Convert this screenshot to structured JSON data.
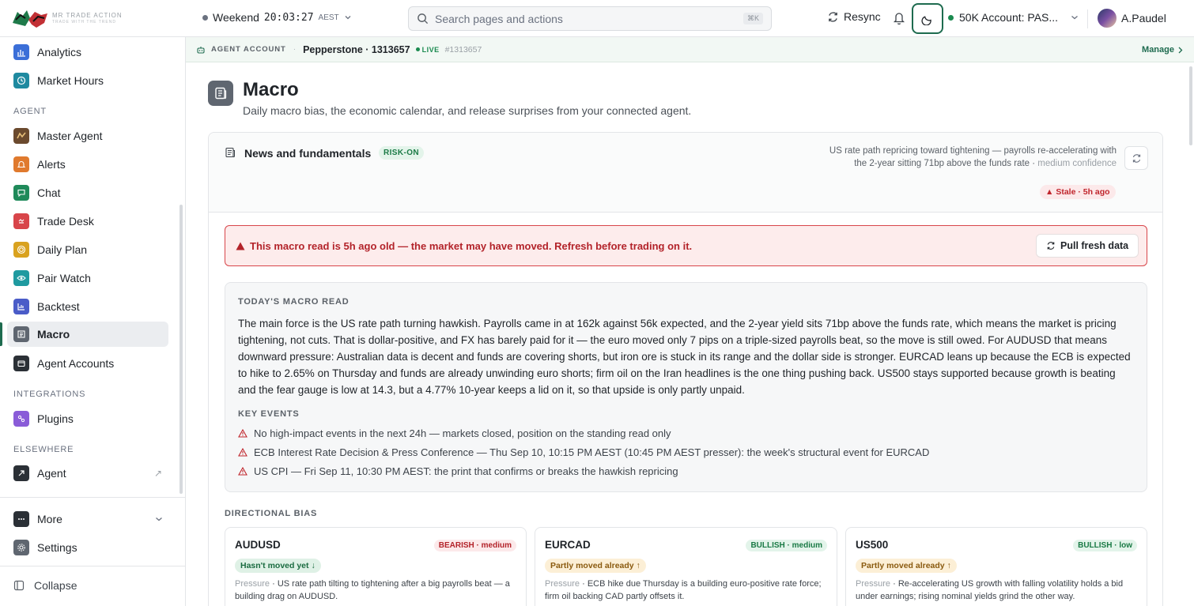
{
  "brand": {
    "name": "MR TRADE ACTION",
    "tagline": "TRADE WITH THE TREND"
  },
  "topbar": {
    "session_label": "Weekend",
    "clock": "20:03:27",
    "timezone": "AEST",
    "search_placeholder": "Search pages and actions",
    "search_shortcut": "⌘K",
    "resync_label": "Resync",
    "account_label": "50K Account: PAS...",
    "user_name": "A.Paudel"
  },
  "sidebar": {
    "items_top": [
      {
        "label": "Analytics",
        "color": "#3b6fd8"
      },
      {
        "label": "Market Hours",
        "color": "#1f8aa0"
      }
    ],
    "agent_header": "AGENT",
    "agent_items": [
      {
        "label": "Master Agent",
        "color": "#6b4a2e"
      },
      {
        "label": "Alerts",
        "color": "#e07a2e"
      },
      {
        "label": "Chat",
        "color": "#1f8a5a"
      },
      {
        "label": "Trade Desk",
        "color": "#d8454a"
      },
      {
        "label": "Daily Plan",
        "color": "#d9a21f"
      },
      {
        "label": "Pair Watch",
        "color": "#1f9aa0"
      },
      {
        "label": "Backtest",
        "color": "#4a5cc8"
      },
      {
        "label": "Macro",
        "color": "#5f6670"
      },
      {
        "label": "Agent Accounts",
        "color": "#2b3036"
      }
    ],
    "integrations_header": "INTEGRATIONS",
    "integration_items": [
      {
        "label": "Plugins",
        "color": "#8a5cd8"
      }
    ],
    "elsewhere_header": "ELSEWHERE",
    "elsewhere_items": [
      {
        "label": "Agent",
        "color": "#2b3036"
      }
    ],
    "more_label": "More",
    "settings_label": "Settings",
    "collapse_label": "Collapse"
  },
  "agent_strip": {
    "label": "AGENT ACCOUNT",
    "broker": "Pepperstone · 1313657",
    "status": "LIVE",
    "account_id": "#1313657",
    "manage_label": "Manage"
  },
  "page": {
    "title": "Macro",
    "subtitle": "Daily macro bias, the economic calendar, and release surprises from your connected agent."
  },
  "news": {
    "title": "News and fundamentals",
    "regime": "RISK-ON",
    "headline": "US rate path repricing toward tightening — payrolls re-accelerating with the 2-year sitting 71bp above the funds rate ·",
    "confidence": "medium confidence",
    "stale": "Stale · 5h ago"
  },
  "alert": {
    "text": "This macro read is 5h ago old — the market may have moved. Refresh before trading on it.",
    "button": "Pull fresh data"
  },
  "macro_read": {
    "heading": "TODAY'S MACRO READ",
    "body": "The main force is the US rate path turning hawkish. Payrolls came in at 162k against 56k expected, and the 2-year yield sits 71bp above the funds rate, which means the market is pricing tightening, not cuts. That is dollar-positive, and FX has barely paid for it — the euro moved only 7 pips on a triple-sized payrolls beat, so the move is still owed. For AUDUSD that means downward pressure: Australian data is decent and funds are covering shorts, but iron ore is stuck in its range and the dollar side is stronger. EURCAD leans up because the ECB is expected to hike to 2.65% on Thursday and funds are already unwinding euro shorts; firm oil on the Iran headlines is the one thing pushing back. US500 stays supported because growth is beating and the fear gauge is low at 14.3, but a 4.77% 10-year keeps a lid on it, so that upside is only partly unpaid.",
    "key_events_heading": "KEY EVENTS",
    "events": [
      "No high-impact events in the next 24h — markets closed, position on the standing read only",
      "ECB Interest Rate Decision & Press Conference — Thu Sep 10, 10:15 PM AEST (10:45 PM AEST presser): the week's structural event for EURCAD",
      "US CPI — Fri Sep 11, 10:30 PM AEST: the print that confirms or breaks the hawkish repricing"
    ]
  },
  "directional_bias": {
    "heading": "DIRECTIONAL BIAS",
    "pressure_label": "Pressure",
    "cards": [
      {
        "pair": "AUDUSD",
        "bias": "BEARISH · medium",
        "move": "Hasn't moved yet ↓",
        "pressure": "US rate path tilting to tightening after a big payrolls beat — a building drag on AUDUSD."
      },
      {
        "pair": "EURCAD",
        "bias": "BULLISH · medium",
        "move": "Partly moved already ↑",
        "pressure": "ECB hike due Thursday is a building euro-positive rate force; firm oil backing CAD partly offsets it."
      },
      {
        "pair": "US500",
        "bias": "BULLISH · low",
        "move": "Partly moved already ↑",
        "pressure": "Re-accelerating US growth with falling volatility holds a bid under earnings; rising nominal yields grind the other way."
      }
    ]
  }
}
